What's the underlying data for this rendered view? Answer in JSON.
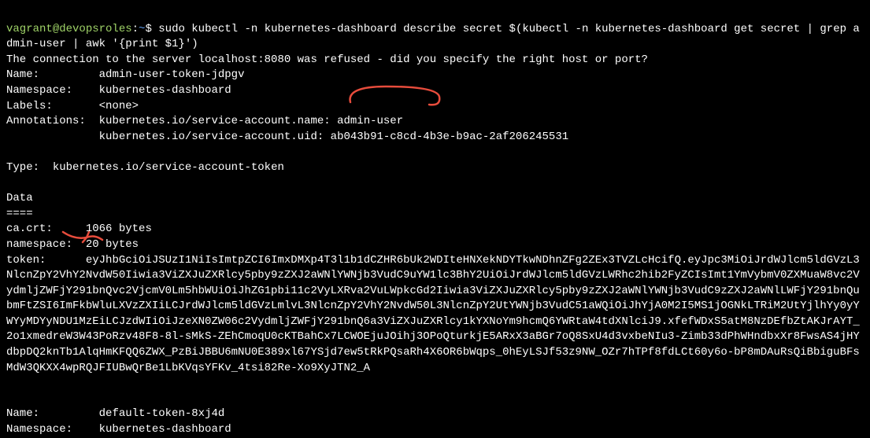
{
  "prompt": {
    "user": "vagrant",
    "host": "devopsroles",
    "path": "~",
    "symbol": "$"
  },
  "command": "sudo kubectl -n kubernetes-dashboard describe secret $(kubectl -n kubernetes-dashboard get secret | grep admin-user | awk '{print $1}')",
  "output": {
    "connection_error": "The connection to the server localhost:8080 was refused - did you specify the right host or port?",
    "name_label": "Name:",
    "name_value": "admin-user-token-jdpgv",
    "namespace_label": "Namespace:",
    "namespace_value": "kubernetes-dashboard",
    "labels_label": "Labels:",
    "labels_value": "<none>",
    "annotations_label": "Annotations:",
    "annotations_value1": "kubernetes.io/service-account.name: admin-user",
    "annotations_value2": "kubernetes.io/service-account.uid: ab043b91-c8cd-4b3e-b9ac-2af206245531",
    "type_label": "Type:",
    "type_value": "kubernetes.io/service-account-token",
    "data_header": "Data",
    "data_divider": "====",
    "ca_crt_label": "ca.crt:",
    "ca_crt_value": "1066 bytes",
    "ns_label": "namespace:",
    "ns_value": "20 bytes",
    "token_label": "token:",
    "token_value": "eyJhbGciOiJSUzI1NiIsImtpZCI6ImxDMXp4T3l1b1dCZHR6bUk2WDIteHNXekNDYTkwNDhnZFg2ZEx3TVZLcHcifQ.eyJpc3MiOiJrdWJlcm5ldGVzL3NlcnZpY2VhY2NvdW50Iiwia3ViZXJuZXRlcy5pby9zZXJ2aWNlYWNjb3VudC9uYW1lc3BhY2UiOiJrdWJlcm5ldGVzLWRhc2hib2FyZCIsImt1YmVybmV0ZXMuaW8vc2VydmljZWFjY291bnQvc2VjcmV0Lm5hbWUiOiJhZG1pbi11c2VyLXRva2VuLWpkcGd2Iiwia3ViZXJuZXRlcy5pby9zZXJ2aWNlYWNjb3VudC9zZXJ2aWNlLWFjY291bnQubmFtZSI6ImFkbWluLXVzZXIiLCJrdWJlcm5ldGVzLmlvL3NlcnZpY2VhY2NvdW50L3NlcnZpY2UtYWNjb3VudC51aWQiOiJhYjA0M2I5MS1jOGNkLTRiM2UtYjlhYy0yYWYyMDYyNDU1MzEiLCJzdWIiOiJzeXN0ZW06c2VydmljZWFjY291bnQ6a3ViZXJuZXRlcy1kYXNoYm9hcmQ6YWRtaW4tdXNlciJ9.xfefWDxS5atM8NzDEfbZtAKJrAYT_2o1xmedreW3W43PoRzv48F8-8l-sMkS-ZEhCmoqU0cKTBahCx7LCWOEjuJOihj3OPoQturkjE5ARxX3aBGr7oQ8SxU4d3vxbeNIu3-Zimb33dPhWHndbxXr8FwsAS4jHYdbpDQ2knTb1AlqHmKFQQ6ZWX_PzBiJBBU6mNU0E389xl67YSjd7ew5tRkPQsaRh4X6OR6bWqps_0hEyLSJf53z9NW_OZr7hTPf8fdLCt60y6o-bP8mDAuRsQiBbiguBFsMdW3QKXX4wpRQJFIUBwQrBe1LbKVqsYFKv_4tsi82Re-Xo9XyJTN2_A",
    "name2_label": "Name:",
    "name2_value": "default-token-8xj4d",
    "namespace2_label": "Namespace:",
    "namespace2_value": "kubernetes-dashboard"
  }
}
